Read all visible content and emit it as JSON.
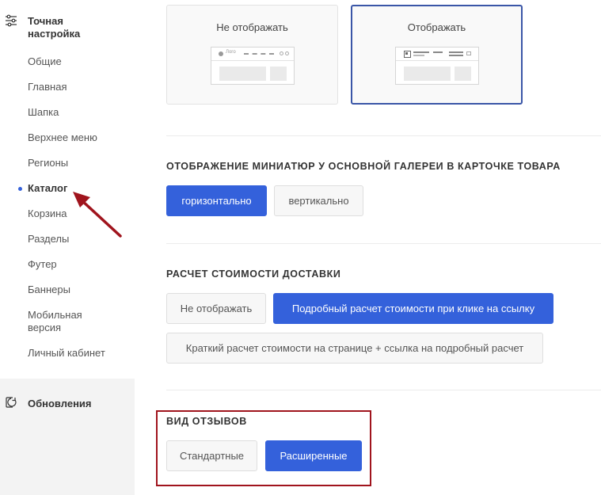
{
  "sidebar": {
    "header_title": "Точная настройка",
    "items": [
      {
        "label": "Общие"
      },
      {
        "label": "Главная"
      },
      {
        "label": "Шапка"
      },
      {
        "label": "Верхнее меню"
      },
      {
        "label": "Регионы"
      },
      {
        "label": "Каталог",
        "active": true
      },
      {
        "label": "Корзина"
      },
      {
        "label": "Разделы"
      },
      {
        "label": "Футер"
      },
      {
        "label": "Баннеры"
      },
      {
        "label": "Мобильная версия"
      },
      {
        "label": "Личный кабинет"
      }
    ],
    "updates_label": "Обновления"
  },
  "display_options": {
    "hide_label": "Не отображать",
    "hide_preview_logo": "Лого",
    "show_label": "Отображать",
    "selected": "show"
  },
  "thumbnails": {
    "title": "ОТОБРАЖЕНИЕ МИНИАТЮР У ОСНОВНОЙ ГАЛЕРЕИ В КАРТОЧКЕ ТОВАРА",
    "horizontal_label": "горизонтально",
    "vertical_label": "вертикально",
    "selected": "horizontal"
  },
  "delivery": {
    "title": "РАСЧЕТ СТОИМОСТИ ДОСТАВКИ",
    "hide_label": "Не отображать",
    "detailed_label": "Подробный расчет стоимости при клике на ссылку",
    "short_label": "Краткий расчет стоимости на странице + ссылка на подробный расчет",
    "selected": "detailed"
  },
  "reviews": {
    "title": "ВИД ОТЗЫВОВ",
    "standard_label": "Стандартные",
    "extended_label": "Расширенные",
    "selected": "extended"
  },
  "colors": {
    "accent": "#3461db",
    "selected_border": "#3a56a7",
    "annotation": "#a0141d",
    "active_dot": "#3461db"
  },
  "annotations": {
    "arrow_target": "Каталог",
    "highlight_target": "ВИД ОТЗЫВОВ"
  }
}
